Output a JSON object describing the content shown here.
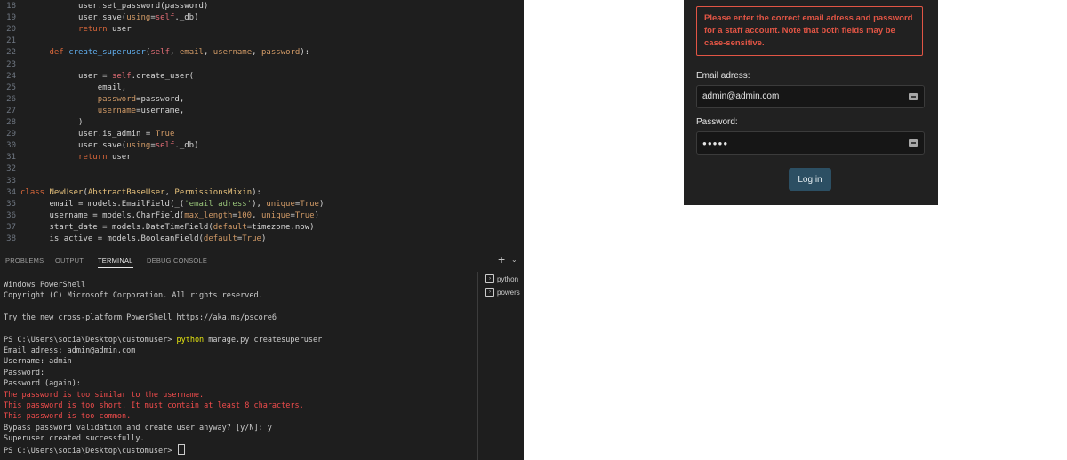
{
  "editor": {
    "lines": [
      {
        "n": "18",
        "segs": [
          {
            "t": "            user.set_password(password)",
            "c": ""
          }
        ]
      },
      {
        "n": "19",
        "segs": [
          {
            "t": "            user.save(",
            "c": ""
          },
          {
            "t": "using",
            "c": "arg"
          },
          {
            "t": "=",
            "c": ""
          },
          {
            "t": "self",
            "c": "self"
          },
          {
            "t": "._db)",
            "c": ""
          }
        ]
      },
      {
        "n": "20",
        "segs": [
          {
            "t": "            ",
            "c": ""
          },
          {
            "t": "return",
            "c": "kw"
          },
          {
            "t": " user",
            "c": ""
          }
        ]
      },
      {
        "n": "21",
        "segs": []
      },
      {
        "n": "22",
        "segs": [
          {
            "t": "      ",
            "c": ""
          },
          {
            "t": "def",
            "c": "kw"
          },
          {
            "t": " ",
            "c": ""
          },
          {
            "t": "create_superuser",
            "c": "fn"
          },
          {
            "t": "(",
            "c": ""
          },
          {
            "t": "self",
            "c": "self"
          },
          {
            "t": ", ",
            "c": ""
          },
          {
            "t": "email",
            "c": "arg"
          },
          {
            "t": ", ",
            "c": ""
          },
          {
            "t": "username",
            "c": "arg"
          },
          {
            "t": ", ",
            "c": ""
          },
          {
            "t": "password",
            "c": "arg"
          },
          {
            "t": "):",
            "c": ""
          }
        ]
      },
      {
        "n": "23",
        "segs": []
      },
      {
        "n": "24",
        "segs": [
          {
            "t": "            user = ",
            "c": ""
          },
          {
            "t": "self",
            "c": "self"
          },
          {
            "t": ".create_user(",
            "c": ""
          }
        ]
      },
      {
        "n": "25",
        "segs": [
          {
            "t": "                email,",
            "c": ""
          }
        ]
      },
      {
        "n": "26",
        "segs": [
          {
            "t": "                ",
            "c": ""
          },
          {
            "t": "password",
            "c": "arg"
          },
          {
            "t": "=password,",
            "c": ""
          }
        ]
      },
      {
        "n": "27",
        "segs": [
          {
            "t": "                ",
            "c": ""
          },
          {
            "t": "username",
            "c": "arg"
          },
          {
            "t": "=username,",
            "c": ""
          }
        ]
      },
      {
        "n": "28",
        "segs": [
          {
            "t": "            )",
            "c": ""
          }
        ]
      },
      {
        "n": "29",
        "segs": [
          {
            "t": "            user.is_admin = ",
            "c": ""
          },
          {
            "t": "True",
            "c": "num"
          }
        ]
      },
      {
        "n": "30",
        "segs": [
          {
            "t": "            user.save(",
            "c": ""
          },
          {
            "t": "using",
            "c": "arg"
          },
          {
            "t": "=",
            "c": ""
          },
          {
            "t": "self",
            "c": "self"
          },
          {
            "t": "._db)",
            "c": ""
          }
        ]
      },
      {
        "n": "31",
        "segs": [
          {
            "t": "            ",
            "c": ""
          },
          {
            "t": "return",
            "c": "kw"
          },
          {
            "t": " user",
            "c": ""
          }
        ]
      },
      {
        "n": "32",
        "segs": []
      },
      {
        "n": "33",
        "segs": []
      },
      {
        "n": "34",
        "segs": [
          {
            "t": "class",
            "c": "kw"
          },
          {
            "t": " ",
            "c": ""
          },
          {
            "t": "NewUser",
            "c": "cls"
          },
          {
            "t": "(",
            "c": ""
          },
          {
            "t": "AbstractBaseUser",
            "c": "cls"
          },
          {
            "t": ", ",
            "c": ""
          },
          {
            "t": "PermissionsMixin",
            "c": "cls"
          },
          {
            "t": "):",
            "c": ""
          }
        ]
      },
      {
        "n": "35",
        "segs": [
          {
            "t": "      email = models.EmailField(_(",
            "c": ""
          },
          {
            "t": "'email adress'",
            "c": "str"
          },
          {
            "t": "), ",
            "c": ""
          },
          {
            "t": "unique",
            "c": "arg"
          },
          {
            "t": "=",
            "c": ""
          },
          {
            "t": "True",
            "c": "num"
          },
          {
            "t": ")",
            "c": ""
          }
        ]
      },
      {
        "n": "36",
        "segs": [
          {
            "t": "      username = models.CharField(",
            "c": ""
          },
          {
            "t": "max_length",
            "c": "arg"
          },
          {
            "t": "=",
            "c": ""
          },
          {
            "t": "100",
            "c": "num"
          },
          {
            "t": ", ",
            "c": ""
          },
          {
            "t": "unique",
            "c": "arg"
          },
          {
            "t": "=",
            "c": ""
          },
          {
            "t": "True",
            "c": "num"
          },
          {
            "t": ")",
            "c": ""
          }
        ]
      },
      {
        "n": "37",
        "segs": [
          {
            "t": "      start_date = models.DateTimeField(",
            "c": ""
          },
          {
            "t": "default",
            "c": "arg"
          },
          {
            "t": "=timezone.now)",
            "c": ""
          }
        ]
      },
      {
        "n": "38",
        "segs": [
          {
            "t": "      is_active = models.BooleanField(",
            "c": ""
          },
          {
            "t": "default",
            "c": "arg"
          },
          {
            "t": "=",
            "c": ""
          },
          {
            "t": "True",
            "c": "num"
          },
          {
            "t": ")",
            "c": ""
          }
        ]
      }
    ]
  },
  "panel": {
    "tabs": [
      {
        "label": "PROBLEMS",
        "active": false
      },
      {
        "label": "OUTPUT",
        "active": false
      },
      {
        "label": "TERMINAL",
        "active": true
      },
      {
        "label": "DEBUG CONSOLE",
        "active": false
      }
    ],
    "plus_icon": "plus-icon",
    "chevron_icon": "chevron-down-icon"
  },
  "terminal": {
    "lines": [
      {
        "text": "Windows PowerShell",
        "style": "normal"
      },
      {
        "text": "Copyright (C) Microsoft Corporation. All rights reserved.",
        "style": "normal"
      },
      {
        "text": "",
        "style": "normal"
      },
      {
        "text": "Try the new cross-platform PowerShell https://aka.ms/pscore6",
        "style": "normal"
      },
      {
        "text": "",
        "style": "normal"
      },
      {
        "prefix": "PS C:\\Users\\socia\\Desktop\\customuser> ",
        "cmd": "python",
        "rest": " manage.py createsuperuser",
        "style": "cmd"
      },
      {
        "text": "Email adress: admin@admin.com",
        "style": "normal"
      },
      {
        "text": "Username: admin",
        "style": "normal"
      },
      {
        "text": "Password:",
        "style": "normal"
      },
      {
        "text": "Password (again):",
        "style": "normal"
      },
      {
        "text": "The password is too similar to the username.",
        "style": "error"
      },
      {
        "text": "This password is too short. It must contain at least 8 characters.",
        "style": "error"
      },
      {
        "text": "This password is too common.",
        "style": "error"
      },
      {
        "text": "Bypass password validation and create user anyway? [y/N]: y",
        "style": "normal"
      },
      {
        "text": "Superuser created successfully.",
        "style": "normal"
      },
      {
        "text": "PS C:\\Users\\socia\\Desktop\\customuser> ",
        "style": "prompt"
      }
    ],
    "sessions": [
      {
        "label": "python",
        "icon": "terminal-icon"
      },
      {
        "label": "powers",
        "icon": "terminal-icon"
      }
    ]
  },
  "login": {
    "error_message": "Please enter the correct email adress and password for a staff account. Note that both fields may be case-sensitive.",
    "email_label": "Email adress:",
    "email_value": "admin@admin.com",
    "password_label": "Password:",
    "password_value": "●●●●●",
    "submit_label": "Log in",
    "error_color": "#e25545",
    "button_color": "#2c4f63"
  }
}
